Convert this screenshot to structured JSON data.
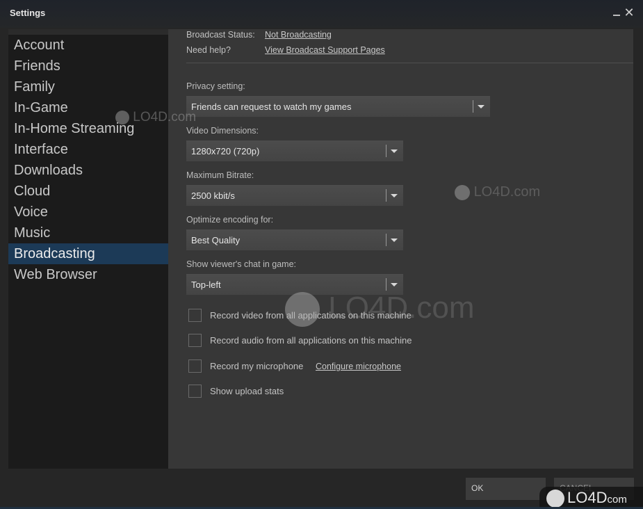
{
  "window": {
    "title": "Settings",
    "minimize_icon": "minimize-icon",
    "close_glyph": "✕"
  },
  "sidebar": {
    "items": [
      {
        "label": "Account",
        "active": false
      },
      {
        "label": "Friends",
        "active": false
      },
      {
        "label": "Family",
        "active": false
      },
      {
        "label": "In-Game",
        "active": false
      },
      {
        "label": "In-Home Streaming",
        "active": false
      },
      {
        "label": "Interface",
        "active": false
      },
      {
        "label": "Downloads",
        "active": false
      },
      {
        "label": "Cloud",
        "active": false
      },
      {
        "label": "Voice",
        "active": false
      },
      {
        "label": "Music",
        "active": false
      },
      {
        "label": "Broadcasting",
        "active": true
      },
      {
        "label": "Web Browser",
        "active": false
      }
    ],
    "active_color": "#1c3a57"
  },
  "broadcast": {
    "status_label": "Broadcast Status:",
    "status_value": "Not Broadcasting",
    "help_label": "Need help?",
    "help_link": "View Broadcast Support Pages",
    "privacy": {
      "label": "Privacy setting:",
      "value": "Friends can request to watch my games"
    },
    "dimensions": {
      "label": "Video Dimensions:",
      "value": "1280x720 (720p)"
    },
    "bitrate": {
      "label": "Maximum Bitrate:",
      "value": "2500 kbit/s"
    },
    "encoding": {
      "label": "Optimize encoding for:",
      "value": "Best Quality"
    },
    "chat": {
      "label": "Show viewer's chat in game:",
      "value": "Top-left"
    },
    "checkboxes": [
      {
        "label": "Record video from all applications on this machine",
        "checked": false
      },
      {
        "label": "Record audio from all applications on this machine",
        "checked": false
      },
      {
        "label": "Record my microphone",
        "checked": false,
        "link": "Configure microphone"
      },
      {
        "label": "Show upload stats",
        "checked": false
      }
    ]
  },
  "footer": {
    "ok_label": "OK",
    "cancel_label": "CANCEL"
  },
  "watermark": {
    "text": "LO4D",
    "suffix": "com",
    "full": "LO4D.com"
  }
}
